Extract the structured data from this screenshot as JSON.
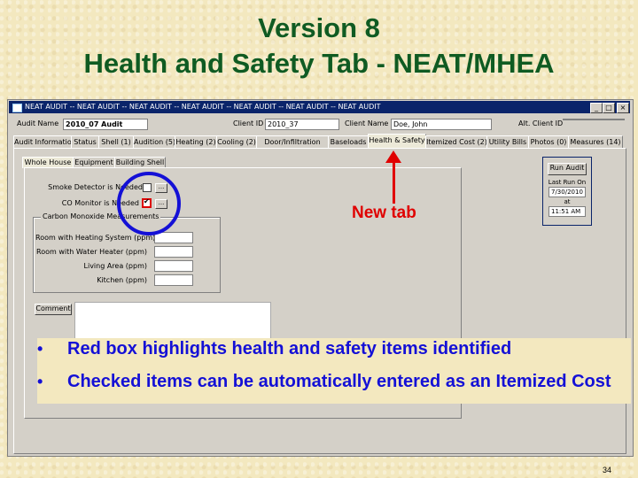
{
  "slide": {
    "title_line1": "Version 8",
    "title_line2": "Health and Safety Tab - NEAT/MHEA",
    "page_number": "34",
    "annotation_new_tab": "New tab",
    "bullets": [
      "Red box highlights health and safety items identified",
      "Checked items can be automatically entered as an Itemized Cost"
    ],
    "colors": {
      "title": "#0f5b22",
      "bullets": "#1410d6",
      "highlight_red": "#e00000",
      "circle_blue": "#1410d6"
    }
  },
  "window": {
    "title": "NEAT AUDIT -- NEAT AUDIT -- NEAT AUDIT -- NEAT AUDIT -- NEAT AUDIT -- NEAT AUDIT -- NEAT AUDIT",
    "buttons": {
      "minimize": "_",
      "maximize": "□",
      "close": "×"
    },
    "audit_name_label": "Audit Name",
    "audit_name_value": "2010_07 Audit",
    "client_id_label": "Client ID",
    "client_id_value": "2010_37",
    "client_name_label": "Client Name",
    "client_name_value": "Doe, John",
    "alt_client_id_label": "Alt. Client ID"
  },
  "tabs": [
    "Audit Information",
    "Status",
    "Shell (1)",
    "Audition (5)",
    "Heating (2)",
    "Cooling (2)",
    "Door/Infiltration",
    "Baseloads",
    "Health & Safety",
    "Itemized Cost (2)",
    "Utility Bills",
    "Photos (0)",
    "Measures (14)"
  ],
  "subtabs": [
    "Whole House",
    "Equipment",
    "Building Shell"
  ],
  "form": {
    "smoke_detector_label": "Smoke Detector is Needed",
    "co_monitor_label": "CO Monitor is Needed",
    "ellipsis": "...",
    "co_group_label": "Carbon Monoxide Measurements",
    "co_rows": [
      "Room with Heating System (ppm)",
      "Room with Water Heater (ppm)",
      "Living Area (ppm)",
      "Kitchen (ppm)"
    ],
    "comment_button": "Comment"
  },
  "sidebar": {
    "run_audit": "Run Audit",
    "last_run_label": "Last Run On",
    "last_run_date": "7/30/2010",
    "at_label": "at",
    "time": "11:51 AM"
  }
}
